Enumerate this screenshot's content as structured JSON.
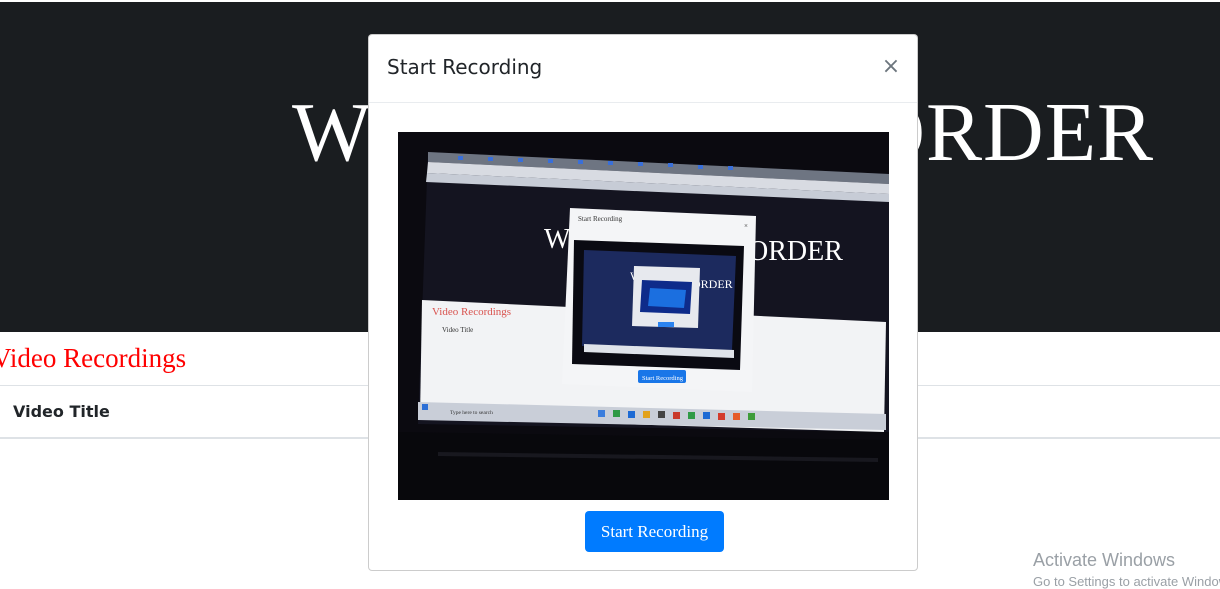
{
  "page": {
    "hero_title": "WEBCAM RECORDER",
    "section_heading": "Video Recordings",
    "table_header": "Video Title",
    "watermark": "Activate Windows",
    "watermark_sub": "Go to Settings to activate Windows."
  },
  "modal": {
    "title": "Start Recording",
    "close_symbol": "×",
    "start_button_label": "Start Recording"
  },
  "feed": {
    "inner_dialog_title": "Start Recording",
    "inner_hero_left": "W",
    "inner_hero_right": "ORDER",
    "inner_section_heading": "Video Recordings",
    "inner_table_header": "Video Title",
    "inner_button_label": "Start Recording",
    "taskbar_search": "Type here to search",
    "deep_hero_left": "W",
    "deep_hero_right": "ORDER"
  },
  "colors": {
    "hero_bg": "#1a1d20",
    "heading_red": "#ff0000",
    "button_blue": "#007bff"
  }
}
